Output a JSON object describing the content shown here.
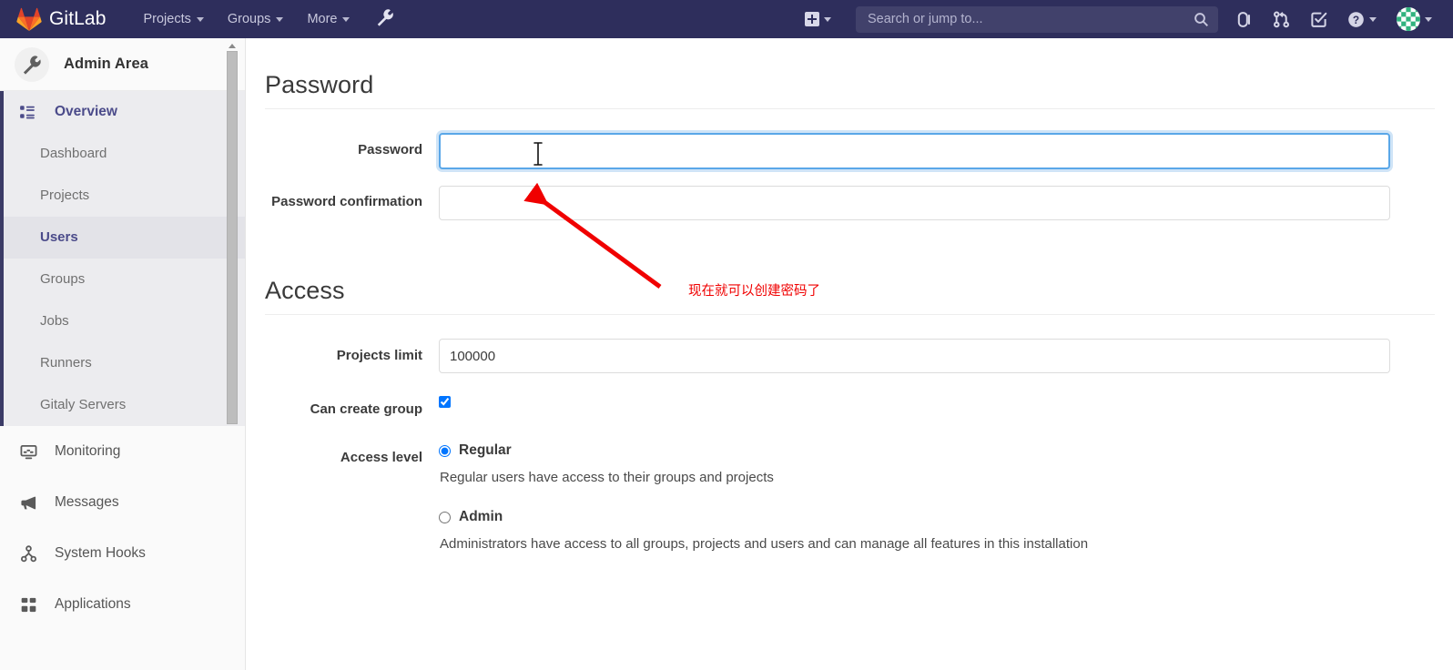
{
  "navbar": {
    "brand": "GitLab",
    "brand_logo_icon": "gitlab-tanuki-logo",
    "items": [
      {
        "label": "Projects",
        "icon": "chevron-down-icon"
      },
      {
        "label": "Groups",
        "icon": "chevron-down-icon"
      },
      {
        "label": "More",
        "icon": "chevron-down-icon"
      }
    ],
    "admin_wrench_icon": "wrench-icon",
    "create_new_icon": "plus-square-icon",
    "create_new_caret_icon": "chevron-down-icon",
    "search": {
      "placeholder": "Search or jump to...",
      "value": "",
      "icon": "search-icon"
    },
    "right_icons": [
      {
        "name": "issues-icon",
        "label": "Issues"
      },
      {
        "name": "merge-requests-icon",
        "label": "Merge requests"
      },
      {
        "name": "todos-icon",
        "label": "To-Do List"
      },
      {
        "name": "help-icon",
        "label": "Help"
      }
    ],
    "help_caret_icon": "chevron-down-icon",
    "avatar_icon": "user-avatar-identicon",
    "avatar_caret_icon": "chevron-down-icon",
    "colors": {
      "background": "#2e2e5c",
      "search_background": "#41416b",
      "text": "#c8c8dd"
    }
  },
  "sidebar": {
    "title": "Admin Area",
    "title_icon": "wrench-icon",
    "sections": [
      {
        "label": "Overview",
        "icon": "overview-grid-icon",
        "active": true,
        "children": [
          {
            "label": "Dashboard",
            "current": false
          },
          {
            "label": "Projects",
            "current": false
          },
          {
            "label": "Users",
            "current": true
          },
          {
            "label": "Groups",
            "current": false
          },
          {
            "label": "Jobs",
            "current": false
          },
          {
            "label": "Runners",
            "current": false
          },
          {
            "label": "Gitaly Servers",
            "current": false
          }
        ]
      }
    ],
    "flat_items": [
      {
        "label": "Monitoring",
        "icon": "monitor-icon"
      },
      {
        "label": "Messages",
        "icon": "megaphone-icon"
      },
      {
        "label": "System Hooks",
        "icon": "hook-icon"
      },
      {
        "label": "Applications",
        "icon": "applications-grid-icon"
      }
    ],
    "scrollbar_icon": "scroll-up-arrow-icon"
  },
  "main": {
    "sections": [
      {
        "heading": "Password",
        "fields": [
          {
            "label": "Password",
            "type": "password",
            "value": "",
            "placeholder": "",
            "focused": true
          },
          {
            "label": "Password confirmation",
            "type": "password",
            "value": "",
            "placeholder": "",
            "focused": false
          }
        ]
      },
      {
        "heading": "Access",
        "projects_limit": {
          "label": "Projects limit",
          "value": "100000"
        },
        "can_create_group": {
          "label": "Can create group",
          "checked": true
        },
        "access_level": {
          "label": "Access level",
          "options": [
            {
              "label": "Regular",
              "selected": true,
              "help": "Regular users have access to their groups and projects"
            },
            {
              "label": "Admin",
              "selected": false,
              "help": "Administrators have access to all groups, projects and users and can manage all features in this installation"
            }
          ]
        }
      }
    ]
  },
  "annotation": {
    "text": "现在就可以创建密码了",
    "color": "#f00000",
    "arrow_icon": "red-arrow-pointing-up-left"
  },
  "cursor": {
    "icon": "text-ibeam-cursor"
  }
}
